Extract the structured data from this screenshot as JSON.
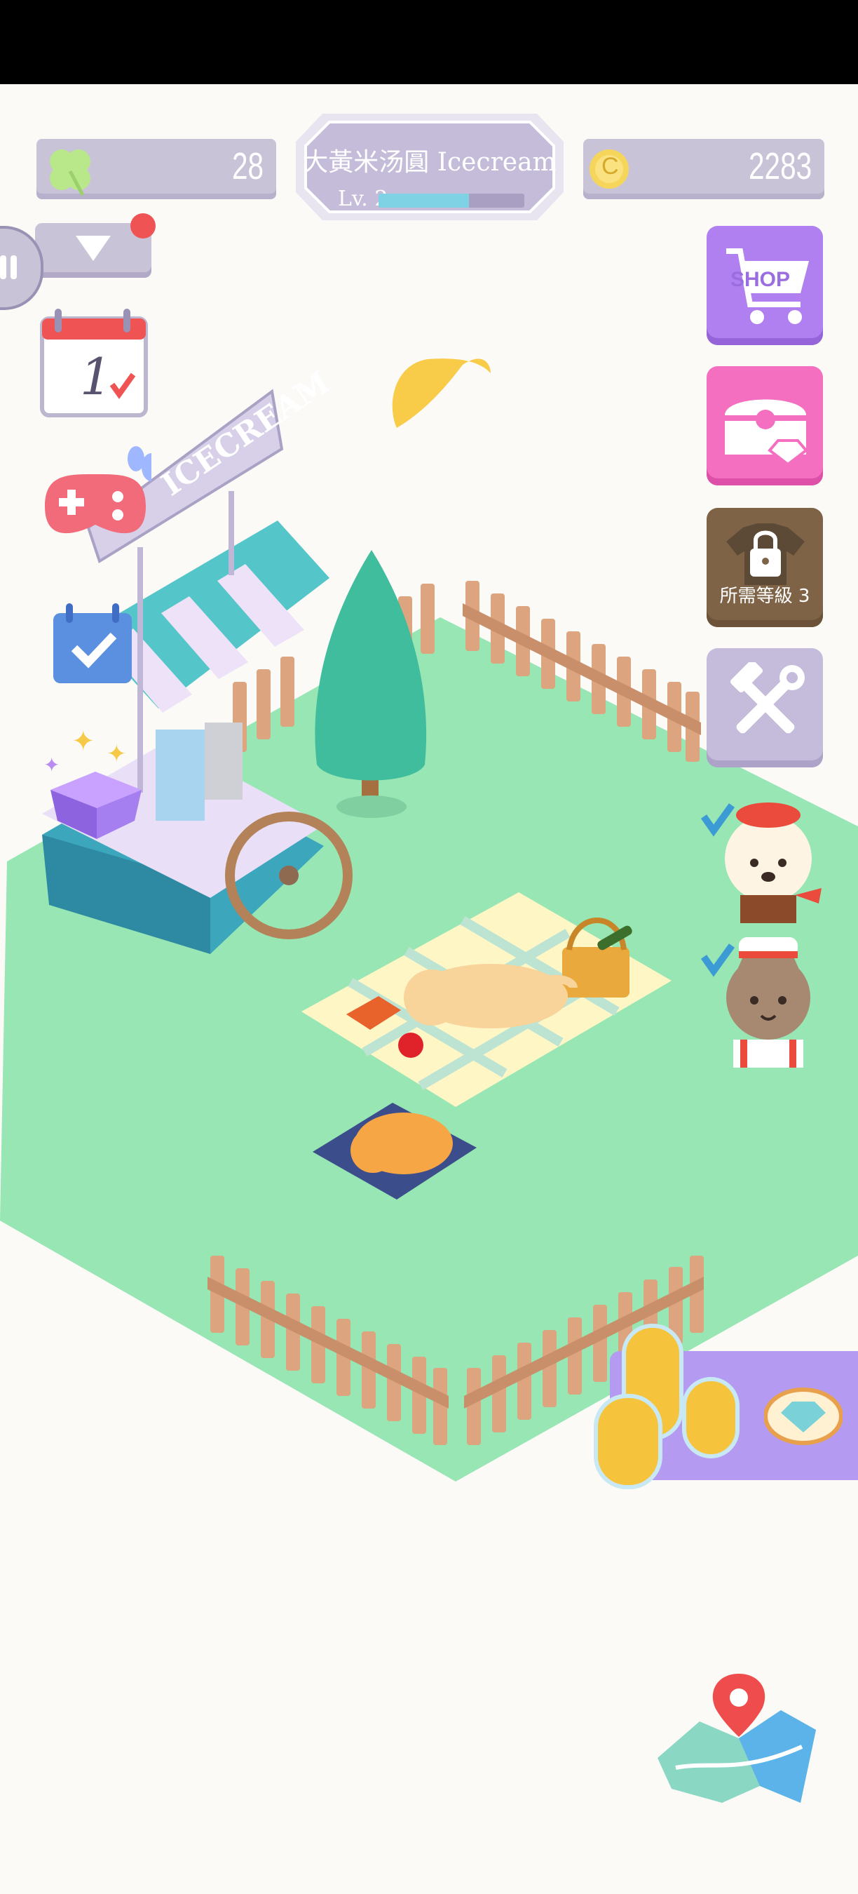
{
  "hud": {
    "clover_count": "28",
    "coin_count": "2283",
    "shop_name": "大黃米汤圓 Icecream",
    "level_label": "Lv. 2",
    "level_progress": 0.62,
    "coin_symbol": "C"
  },
  "side_buttons": {
    "shop_label": "SHOP",
    "locked_label": "所需等級 3"
  },
  "scene": {
    "cart_sign": "ICECREAM",
    "calendar_day": "1"
  },
  "colors": {
    "pill_bg": "#c9c3d8",
    "shop_purple": "#b07ff0",
    "chest_pink": "#f56fc0",
    "locked_brown": "#7e6346",
    "tools_lavender": "#c5bcdb",
    "grass": "#97e6b4",
    "fence": "#dca580",
    "reward_panel": "#b49af0"
  }
}
